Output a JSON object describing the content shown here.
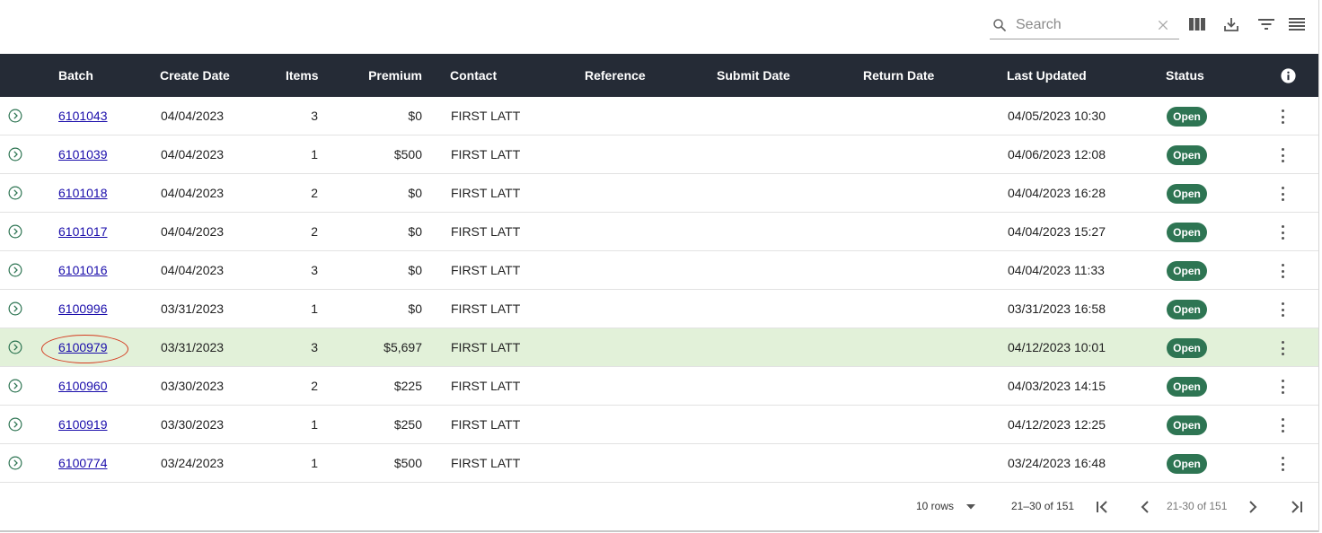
{
  "toolbar": {
    "search_placeholder": "Search",
    "icons": [
      "search-icon",
      "clear-icon",
      "columns-icon",
      "download-icon",
      "filter-icon",
      "density-icon"
    ]
  },
  "table": {
    "headers": {
      "batch": "Batch",
      "create_date": "Create Date",
      "items": "Items",
      "premium": "Premium",
      "contact": "Contact",
      "reference": "Reference",
      "submit_date": "Submit Date",
      "return_date": "Return Date",
      "last_updated": "Last Updated",
      "status": "Status"
    },
    "rows": [
      {
        "batch": "6101043",
        "create_date": "04/04/2023",
        "items": "3",
        "premium": "$0",
        "contact": "FIRST LATT",
        "reference": "",
        "submit_date": "",
        "return_date": "",
        "last_updated": "04/05/2023 10:30",
        "status": "Open",
        "highlighted": false
      },
      {
        "batch": "6101039",
        "create_date": "04/04/2023",
        "items": "1",
        "premium": "$500",
        "contact": "FIRST LATT",
        "reference": "",
        "submit_date": "",
        "return_date": "",
        "last_updated": "04/06/2023 12:08",
        "status": "Open",
        "highlighted": false
      },
      {
        "batch": "6101018",
        "create_date": "04/04/2023",
        "items": "2",
        "premium": "$0",
        "contact": "FIRST LATT",
        "reference": "",
        "submit_date": "",
        "return_date": "",
        "last_updated": "04/04/2023 16:28",
        "status": "Open",
        "highlighted": false
      },
      {
        "batch": "6101017",
        "create_date": "04/04/2023",
        "items": "2",
        "premium": "$0",
        "contact": "FIRST LATT",
        "reference": "",
        "submit_date": "",
        "return_date": "",
        "last_updated": "04/04/2023 15:27",
        "status": "Open",
        "highlighted": false
      },
      {
        "batch": "6101016",
        "create_date": "04/04/2023",
        "items": "3",
        "premium": "$0",
        "contact": "FIRST LATT",
        "reference": "",
        "submit_date": "",
        "return_date": "",
        "last_updated": "04/04/2023 11:33",
        "status": "Open",
        "highlighted": false
      },
      {
        "batch": "6100996",
        "create_date": "03/31/2023",
        "items": "1",
        "premium": "$0",
        "contact": "FIRST LATT",
        "reference": "",
        "submit_date": "",
        "return_date": "",
        "last_updated": "03/31/2023 16:58",
        "status": "Open",
        "highlighted": false
      },
      {
        "batch": "6100979",
        "create_date": "03/31/2023",
        "items": "3",
        "premium": "$5,697",
        "contact": "FIRST LATT",
        "reference": "",
        "submit_date": "",
        "return_date": "",
        "last_updated": "04/12/2023 10:01",
        "status": "Open",
        "highlighted": true
      },
      {
        "batch": "6100960",
        "create_date": "03/30/2023",
        "items": "2",
        "premium": "$225",
        "contact": "FIRST LATT",
        "reference": "",
        "submit_date": "",
        "return_date": "",
        "last_updated": "04/03/2023 14:15",
        "status": "Open",
        "highlighted": false
      },
      {
        "batch": "6100919",
        "create_date": "03/30/2023",
        "items": "1",
        "premium": "$250",
        "contact": "FIRST LATT",
        "reference": "",
        "submit_date": "",
        "return_date": "",
        "last_updated": "04/12/2023 12:25",
        "status": "Open",
        "highlighted": false
      },
      {
        "batch": "6100774",
        "create_date": "03/24/2023",
        "items": "1",
        "premium": "$500",
        "contact": "FIRST LATT",
        "reference": "",
        "submit_date": "",
        "return_date": "",
        "last_updated": "03/24/2023 16:48",
        "status": "Open",
        "highlighted": false
      }
    ]
  },
  "pagination": {
    "rows_per_page": "10 rows",
    "range": "21–30 of 151",
    "range_repeat": "21-30 of 151"
  },
  "colors": {
    "header_bg": "#252b36",
    "status_open": "#2e7553",
    "highlight_row": "#e2f1d9",
    "link": "#1a0dab",
    "annotation_circle": "#d53a1f"
  }
}
